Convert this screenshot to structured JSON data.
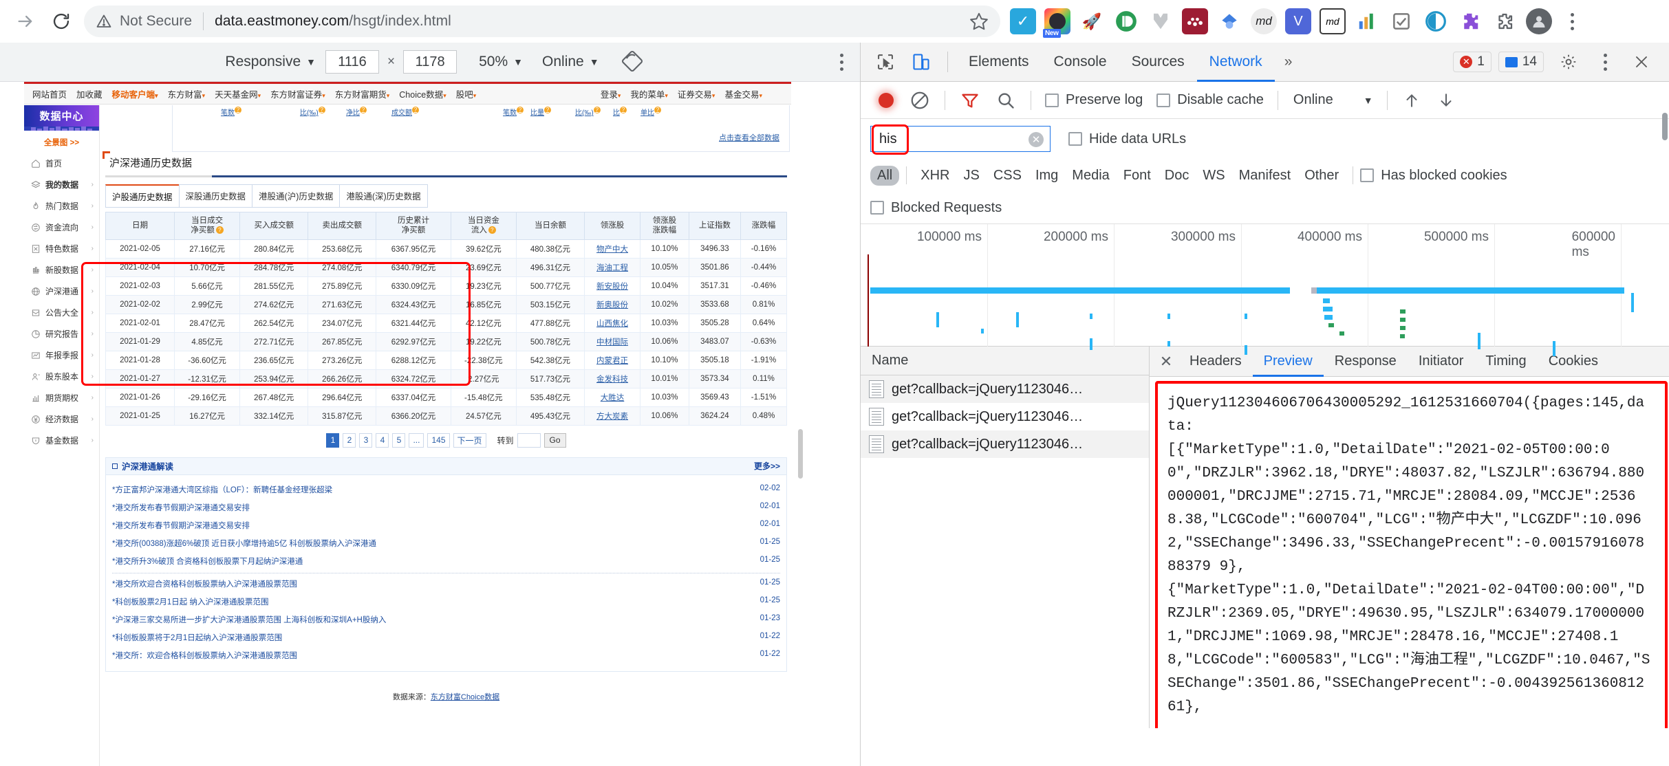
{
  "browser": {
    "security_label": "Not Secure",
    "url_main": "data.eastmoney.com",
    "url_path": "/hsgt/index.html",
    "reload_icon": "reload-icon",
    "forward_icon": "forward-arrow-icon",
    "star_icon": "bookmark-star-icon",
    "extensions": [
      {
        "name": "todoist-extension",
        "glyph": "✓",
        "bg": "#29a7dd",
        "fg": "#ffffff"
      },
      {
        "name": "nimbus-screenshot-extension",
        "glyph": "◉",
        "bg": "#ffffff",
        "fg": "#333333",
        "badge": "New"
      },
      {
        "name": "rocket-extension",
        "glyph": "🚀",
        "bg": "#ffffff",
        "fg": "#4a4a4a"
      },
      {
        "name": "pushbullet-extension",
        "glyph": "ID",
        "bg": "#ffffff",
        "fg": "#2a9d54"
      },
      {
        "name": "markdown-here-extension",
        "glyph": "⬠",
        "bg": "#ffffff",
        "fg": "#b0b0b0"
      },
      {
        "name": "mendeley-extension",
        "glyph": "∴",
        "bg": "#9d1c33",
        "fg": "#ffffff"
      },
      {
        "name": "diamond-extension",
        "glyph": "◆",
        "bg": "#ffffff",
        "fg": "#3f7fe0"
      },
      {
        "name": "md-extension",
        "glyph": "md",
        "bg": "#ececec",
        "fg": "#202124"
      },
      {
        "name": "vimium-extension",
        "glyph": "V",
        "bg": "#4f67d8",
        "fg": "#ffffff"
      },
      {
        "name": "markdown-viewer-extension",
        "glyph": "md",
        "bg": "#ffffff",
        "fg": "#333333"
      },
      {
        "name": "chart-extension",
        "glyph": "█",
        "bg": "#ffffff",
        "fg": "#e8a33d"
      },
      {
        "name": "checkmark-extension",
        "glyph": "✓",
        "bg": "#ffffff",
        "fg": "#7a7a7a"
      },
      {
        "name": "circle-extension",
        "glyph": "◎",
        "bg": "#ffffff",
        "fg": "#2196c9"
      },
      {
        "name": "puzzle-purple-extension",
        "glyph": "❖",
        "bg": "#ffffff",
        "fg": "#8a4fd8"
      },
      {
        "name": "extensions-puzzle-icon",
        "glyph": "🧩",
        "bg": "#ffffff",
        "fg": "#5f6368"
      },
      {
        "name": "profile-avatar",
        "glyph": "●",
        "bg": "#5f6368",
        "fg": "#ffffff"
      }
    ],
    "menu_icon": "chrome-menu-kebab-icon"
  },
  "device_toolbar": {
    "device": "Responsive",
    "width": "1116",
    "x_symbol": "×",
    "height": "1178",
    "zoom": "50%",
    "throttle": "Online",
    "rotate_icon": "rotate-device-icon",
    "menu_icon": "device-toolbar-kebab-icon"
  },
  "page": {
    "topnav_left": [
      {
        "label": "网站首页",
        "caret": false,
        "orange": false
      },
      {
        "label": "加收藏",
        "caret": false,
        "orange": false
      },
      {
        "label": "移动客户端",
        "caret": true,
        "orange": true
      },
      {
        "label": "东方财富",
        "caret": true,
        "orange": false
      },
      {
        "label": "天天基金网",
        "caret": true,
        "orange": false
      },
      {
        "label": "东方财富证券",
        "caret": true,
        "orange": false
      },
      {
        "label": "东方财富期货",
        "caret": true,
        "orange": false
      },
      {
        "label": "Choice数据",
        "caret": true,
        "orange": false
      },
      {
        "label": "股吧",
        "caret": true,
        "orange": false
      }
    ],
    "topnav_right": [
      {
        "label": "登录",
        "caret": true
      },
      {
        "label": "我的菜单",
        "caret": true
      },
      {
        "label": "证券交易",
        "caret": true
      },
      {
        "label": "基金交易",
        "caret": true
      }
    ],
    "ghost_links": [
      "笔数",
      "比(‰)",
      "净比",
      "成交额",
      "笔数",
      "比量",
      "比(‰)",
      "比",
      "单比"
    ],
    "view_all_link": "点击查看全部数据",
    "sidebar": {
      "logo": "数据中心",
      "panorama": "全景图 >>",
      "items": [
        {
          "label": "首页",
          "icon": "home-icon",
          "arrow": false,
          "bold": false
        },
        {
          "label": "我的数据",
          "icon": "layers-icon",
          "arrow": true,
          "bold": true
        },
        {
          "label": "热门数据",
          "icon": "fire-icon",
          "arrow": true,
          "bold": false
        },
        {
          "label": "资金流向",
          "icon": "flow-icon",
          "arrow": true,
          "bold": false
        },
        {
          "label": "特色数据",
          "icon": "star-box-icon",
          "arrow": true,
          "bold": false
        },
        {
          "label": "新股数据",
          "icon": "bars-icon",
          "arrow": true,
          "bold": false
        },
        {
          "label": "沪深港通",
          "icon": "globe-icon",
          "arrow": true,
          "bold": false
        },
        {
          "label": "公告大全",
          "icon": "envelope-icon",
          "arrow": true,
          "bold": false
        },
        {
          "label": "研究报告",
          "icon": "pie-icon",
          "arrow": true,
          "bold": false
        },
        {
          "label": "年报季报",
          "icon": "chart-icon",
          "arrow": true,
          "bold": false
        },
        {
          "label": "股东股本",
          "icon": "person-icon",
          "arrow": true,
          "bold": false
        },
        {
          "label": "期货期权",
          "icon": "histogram-icon",
          "arrow": true,
          "bold": false
        },
        {
          "label": "经济数据",
          "icon": "yen-icon",
          "arrow": true,
          "bold": false
        },
        {
          "label": "基金数据",
          "icon": "shield-icon",
          "arrow": true,
          "bold": false
        }
      ]
    },
    "title": "沪深港通历史数据",
    "tabs": [
      {
        "label": "沪股通历史数据",
        "active": true
      },
      {
        "label": "深股通历史数据",
        "active": false
      },
      {
        "label": "港股通(沪)历史数据",
        "active": false
      },
      {
        "label": "港股通(深)历史数据",
        "active": false
      }
    ],
    "table": {
      "headers": [
        {
          "text": "日期",
          "help": false
        },
        {
          "text": "当日成交\n净买额",
          "help": true
        },
        {
          "text": "买入成交额",
          "help": false
        },
        {
          "text": "卖出成交额",
          "help": false
        },
        {
          "text": "历史累计\n净买额",
          "help": false
        },
        {
          "text": "当日资金\n流入",
          "help": true
        },
        {
          "text": "当日余额",
          "help": false
        },
        {
          "text": "领涨股",
          "help": false
        },
        {
          "text": "领涨股\n涨跌幅",
          "help": false
        },
        {
          "text": "上证指数",
          "help": false
        },
        {
          "text": "涨跌幅",
          "help": false
        }
      ],
      "rows": [
        {
          "date": "2021-02-05",
          "net": "27.16亿元",
          "net_sign": "up",
          "buy": "280.84亿元",
          "sell": "253.68亿元",
          "cum": "6367.95亿元",
          "inflow": "39.62亿元",
          "inflow_sign": "up",
          "bal": "480.38亿元",
          "stock": "物产中大",
          "stock_chg": "10.10%",
          "index": "3496.33",
          "index_chg": "-0.16%",
          "index_chg_sign": "down"
        },
        {
          "date": "2021-02-04",
          "net": "10.70亿元",
          "net_sign": "up",
          "buy": "284.78亿元",
          "sell": "274.08亿元",
          "cum": "6340.79亿元",
          "inflow": "23.69亿元",
          "inflow_sign": "up",
          "bal": "496.31亿元",
          "stock": "海油工程",
          "stock_chg": "10.05%",
          "index": "3501.86",
          "index_chg": "-0.44%",
          "index_chg_sign": "down"
        },
        {
          "date": "2021-02-03",
          "net": "5.66亿元",
          "net_sign": "up",
          "buy": "281.55亿元",
          "sell": "275.89亿元",
          "cum": "6330.09亿元",
          "inflow": "19.23亿元",
          "inflow_sign": "up",
          "bal": "500.77亿元",
          "stock": "新安股份",
          "stock_chg": "10.04%",
          "index": "3517.31",
          "index_chg": "-0.46%",
          "index_chg_sign": "down"
        },
        {
          "date": "2021-02-02",
          "net": "2.99亿元",
          "net_sign": "up",
          "buy": "274.62亿元",
          "sell": "271.63亿元",
          "cum": "6324.43亿元",
          "inflow": "16.85亿元",
          "inflow_sign": "up",
          "bal": "503.15亿元",
          "stock": "新奥股份",
          "stock_chg": "10.02%",
          "index": "3533.68",
          "index_chg": "0.81%",
          "index_chg_sign": "up"
        },
        {
          "date": "2021-02-01",
          "net": "28.47亿元",
          "net_sign": "up",
          "buy": "262.54亿元",
          "sell": "234.07亿元",
          "cum": "6321.44亿元",
          "inflow": "42.12亿元",
          "inflow_sign": "up",
          "bal": "477.88亿元",
          "stock": "山西焦化",
          "stock_chg": "10.03%",
          "index": "3505.28",
          "index_chg": "0.64%",
          "index_chg_sign": "up"
        },
        {
          "date": "2021-01-29",
          "net": "4.85亿元",
          "net_sign": "up",
          "buy": "272.71亿元",
          "sell": "267.85亿元",
          "cum": "6292.97亿元",
          "inflow": "19.22亿元",
          "inflow_sign": "up",
          "bal": "500.78亿元",
          "stock": "中材国际",
          "stock_chg": "10.06%",
          "index": "3483.07",
          "index_chg": "-0.63%",
          "index_chg_sign": "down"
        },
        {
          "date": "2021-01-28",
          "net": "-36.60亿元",
          "net_sign": "down",
          "buy": "236.65亿元",
          "sell": "273.26亿元",
          "cum": "6288.12亿元",
          "inflow": "-22.38亿元",
          "inflow_sign": "down",
          "bal": "542.38亿元",
          "stock": "内蒙君正",
          "stock_chg": "10.10%",
          "index": "3505.18",
          "index_chg": "-1.91%",
          "index_chg_sign": "down"
        },
        {
          "date": "2021-01-27",
          "net": "-12.31亿元",
          "net_sign": "down",
          "buy": "253.94亿元",
          "sell": "266.26亿元",
          "cum": "6324.72亿元",
          "inflow": "2.27亿元",
          "inflow_sign": "up",
          "bal": "517.73亿元",
          "stock": "金发科技",
          "stock_chg": "10.01%",
          "index": "3573.34",
          "index_chg": "0.11%",
          "index_chg_sign": "up"
        },
        {
          "date": "2021-01-26",
          "net": "-29.16亿元",
          "net_sign": "down",
          "buy": "267.48亿元",
          "sell": "296.64亿元",
          "cum": "6337.04亿元",
          "inflow": "-15.48亿元",
          "inflow_sign": "down",
          "bal": "535.48亿元",
          "stock": "大胜达",
          "stock_chg": "10.03%",
          "index": "3569.43",
          "index_chg": "-1.51%",
          "index_chg_sign": "down"
        },
        {
          "date": "2021-01-25",
          "net": "16.27亿元",
          "net_sign": "up",
          "buy": "332.14亿元",
          "sell": "315.87亿元",
          "cum": "6366.20亿元",
          "inflow": "24.57亿元",
          "inflow_sign": "up",
          "bal": "495.43亿元",
          "stock": "方大炭素",
          "stock_chg": "10.06%",
          "index": "3624.24",
          "index_chg": "0.48%",
          "index_chg_sign": "up"
        }
      ]
    },
    "pagination": {
      "pages": [
        "1",
        "2",
        "3",
        "4",
        "5",
        "...",
        "145"
      ],
      "active": "1",
      "next": "下一页",
      "goto_label": "转到",
      "goto_value": "",
      "go_button": "Go"
    },
    "news": {
      "title": "沪深港通解读",
      "more": "更多>>",
      "group1": [
        {
          "text": "*方正富邦沪深港通大湾区综指（LOF）：新聘任基金经理张超梁",
          "date": "02-02"
        },
        {
          "text": "*港交所发布春节假期沪深港通交易安排",
          "date": "02-01"
        },
        {
          "text": "*港交所发布春节假期沪深港通交易安排",
          "date": "02-01"
        },
        {
          "text": "*港交所(00388)涨超6%破顶 近日获小摩增持逾5亿 科创板股票纳入沪深港通",
          "date": "01-25"
        },
        {
          "text": "*港交所升3%破顶 合资格科创板股票下月起纳沪深港通",
          "date": "01-25"
        }
      ],
      "group2": [
        {
          "text": "*港交所欢迎合资格科创板股票纳入沪深港通股票范围",
          "date": "01-25"
        },
        {
          "text": "*科创板股票2月1日起 纳入沪深港通股票范围",
          "date": "01-25"
        },
        {
          "text": "*沪深港三家交易所进一步扩大沪深港通股票范围 上海科创板和深圳A+H股纳入",
          "date": "01-23"
        },
        {
          "text": "*科创板股票将于2月1日起纳入沪深港通股票范围",
          "date": "01-22"
        },
        {
          "text": "*港交所：欢迎合格科创板股票纳入沪深港通股票范围",
          "date": "01-22"
        }
      ]
    },
    "source_label": "数据来源：",
    "source_link": "东方财富Choice数据"
  },
  "devtools": {
    "inspect_icon": "inspect-element-icon",
    "device_toggle_icon": "toggle-device-toolbar-icon",
    "panels": [
      {
        "label": "Elements",
        "active": false
      },
      {
        "label": "Console",
        "active": false
      },
      {
        "label": "Sources",
        "active": false
      },
      {
        "label": "Network",
        "active": true
      }
    ],
    "more_panels": "»",
    "error_count": "1",
    "warning_count": "14",
    "settings_icon": "settings-gear-icon",
    "devtools_menu_icon": "devtools-kebab-icon",
    "close_icon": "close-devtools-icon",
    "action_bar": {
      "record_icon": "record-stop-icon",
      "clear_icon": "clear-network-log-icon",
      "filter_icon": "filter-funnel-icon",
      "search_icon": "search-icon",
      "preserve_log": "Preserve log",
      "disable_cache": "Disable cache",
      "throttle": "Online",
      "import_icon": "import-har-icon",
      "export_icon": "export-har-icon"
    },
    "filter": {
      "value": "his",
      "clear_icon": "clear-filter-icon",
      "hide_data_urls": "Hide data URLs"
    },
    "resource_types": [
      {
        "label": "All",
        "active": true
      },
      {
        "label": "XHR",
        "active": false
      },
      {
        "label": "JS",
        "active": false
      },
      {
        "label": "CSS",
        "active": false
      },
      {
        "label": "Img",
        "active": false
      },
      {
        "label": "Media",
        "active": false
      },
      {
        "label": "Font",
        "active": false
      },
      {
        "label": "Doc",
        "active": false
      },
      {
        "label": "WS",
        "active": false
      },
      {
        "label": "Manifest",
        "active": false
      },
      {
        "label": "Other",
        "active": false
      }
    ],
    "has_blocked_cookies": "Has blocked cookies",
    "blocked_requests": "Blocked Requests",
    "timeline_ticks": [
      "100000 ms",
      "200000 ms",
      "300000 ms",
      "400000 ms",
      "500000 ms",
      "600000 ms"
    ],
    "request_column": "Name",
    "requests": [
      {
        "name": "get?callback=jQuery1123046…",
        "icon": "document-icon"
      },
      {
        "name": "get?callback=jQuery1123046…",
        "icon": "document-icon"
      },
      {
        "name": "get?callback=jQuery1123046…",
        "icon": "document-icon"
      }
    ],
    "detail_tabs": [
      {
        "label": "Headers",
        "active": false
      },
      {
        "label": "Preview",
        "active": true
      },
      {
        "label": "Response",
        "active": false
      },
      {
        "label": "Initiator",
        "active": false
      },
      {
        "label": "Timing",
        "active": false
      },
      {
        "label": "Cookies",
        "active": false
      }
    ],
    "preview_text": "jQuery112304606706430005292_1612531660704({pages:145,data:\n[{\"MarketType\":1.0,\"DetailDate\":\"2021-02-05T00:00:00\",\"DRZJLR\":3962.18,\"DRYE\":48037.82,\"LSZJLR\":636794.880000001,\"DRCJJME\":2715.71,\"MRCJE\":28084.09,\"MCCJE\":25368.38,\"LCGCode\":\"600704\",\"LCG\":\"物产中大\",\"LCGZDF\":10.0962,\"SSEChange\":3496.33,\"SSEChangePrecent\":-0.0015791607888379 9},\n{\"MarketType\":1.0,\"DetailDate\":\"2021-02-04T00:00:00\",\"DRZJLR\":2369.05,\"DRYE\":49630.95,\"LSZJLR\":634079.170000001,\"DRCJJME\":1069.98,\"MRCJE\":28478.16,\"MCCJE\":27408.18,\"LCGCode\":\"600583\",\"LCG\":\"海油工程\",\"LCGZDF\":10.0467,\"SSEChange\":3501.86,\"SSEChangePrecent\":-0.00439256136081261},"
  }
}
